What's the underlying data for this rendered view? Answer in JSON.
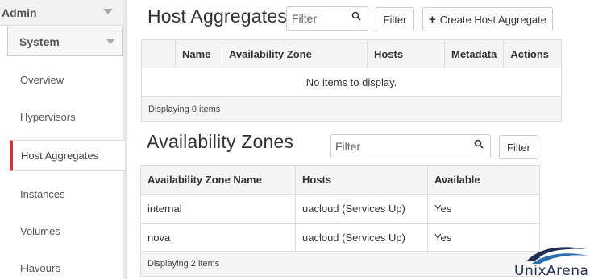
{
  "sidebar": {
    "dashboard": "Admin",
    "panel_group": "System",
    "items": [
      {
        "label": "Overview"
      },
      {
        "label": "Hypervisors"
      },
      {
        "label": "Host Aggregates"
      },
      {
        "label": "Instances"
      },
      {
        "label": "Volumes"
      },
      {
        "label": "Flavours"
      }
    ],
    "active_index": 2,
    "accent_color": "#c9383a"
  },
  "host_aggregates": {
    "title": "Host Aggregates",
    "filter_placeholder": "Filter",
    "filter_button": "Filter",
    "create_button": "Create Host Aggregate",
    "columns": [
      "Name",
      "Availability Zone",
      "Hosts",
      "Metadata",
      "Actions"
    ],
    "empty_message": "No items to display.",
    "footer": "Displaying 0 items"
  },
  "availability_zones": {
    "title": "Availability Zones",
    "filter_placeholder": "Filter",
    "filter_button": "Filter",
    "columns": [
      "Availability Zone Name",
      "Hosts",
      "Available"
    ],
    "rows": [
      [
        "internal",
        "uacloud (Services Up)",
        "Yes"
      ],
      [
        "nova",
        "uacloud (Services Up)",
        "Yes"
      ]
    ],
    "footer": "Displaying 2 items"
  },
  "watermark": {
    "text": "UnixArena"
  },
  "icons": [
    "chevron-down-icon",
    "search-icon",
    "plus-icon",
    "logo-swoosh-icon"
  ]
}
